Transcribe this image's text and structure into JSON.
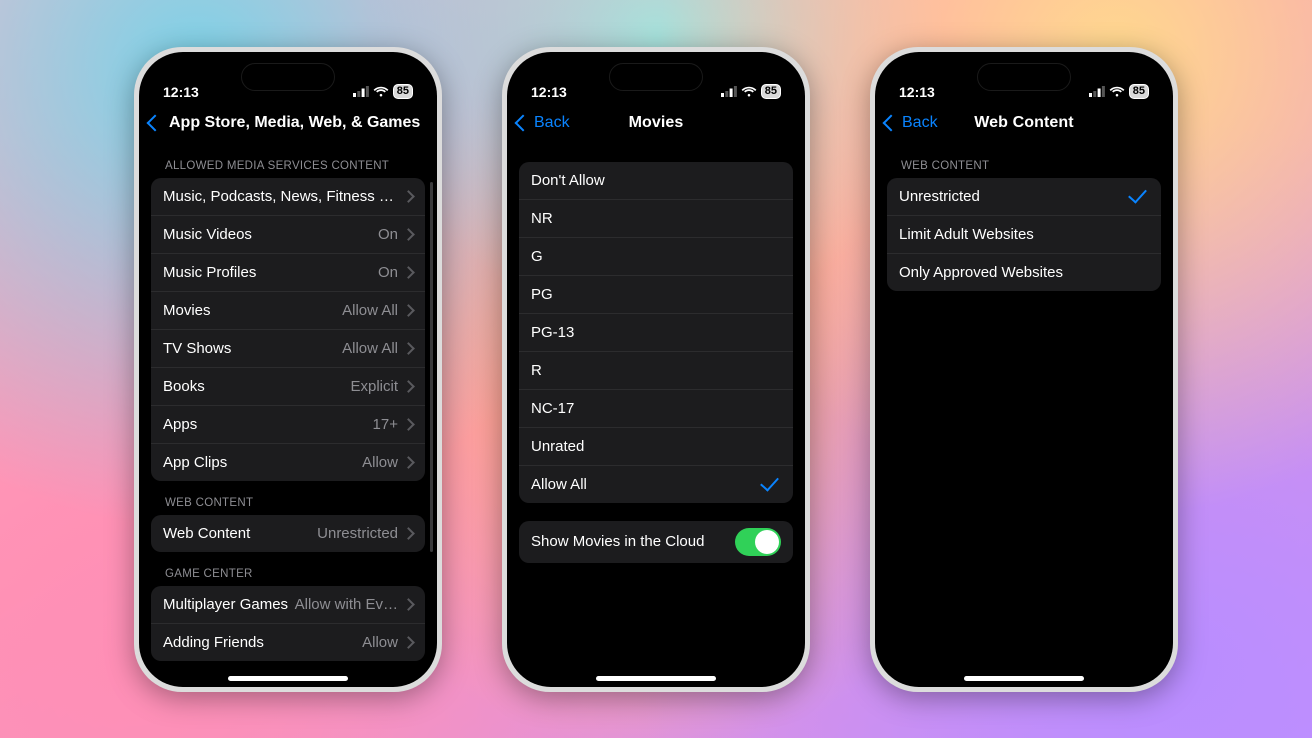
{
  "status": {
    "time": "12:13",
    "battery": "85"
  },
  "phone1": {
    "nav_title": "App Store, Media, Web, & Games",
    "sect1_header": "ALLOWED MEDIA SERVICES CONTENT",
    "rows1": [
      {
        "label": "Music, Podcasts, News, Fitness  …",
        "value": ""
      },
      {
        "label": "Music Videos",
        "value": "On"
      },
      {
        "label": "Music Profiles",
        "value": "On"
      },
      {
        "label": "Movies",
        "value": "Allow All"
      },
      {
        "label": "TV Shows",
        "value": "Allow All"
      },
      {
        "label": "Books",
        "value": "Explicit"
      },
      {
        "label": "Apps",
        "value": "17+"
      },
      {
        "label": "App Clips",
        "value": "Allow"
      }
    ],
    "sect2_header": "WEB CONTENT",
    "row_web": {
      "label": "Web Content",
      "value": "Unrestricted"
    },
    "sect3_header": "GAME CENTER",
    "rows3": [
      {
        "label": "Multiplayer Games",
        "value": "Allow with Ev…"
      },
      {
        "label": "Adding Friends",
        "value": "Allow"
      }
    ]
  },
  "phone2": {
    "back": "Back",
    "nav_title": "Movies",
    "options": [
      "Don't Allow",
      "NR",
      "G",
      "PG",
      "PG-13",
      "R",
      "NC-17",
      "Unrated",
      "Allow All"
    ],
    "selected_index": 8,
    "toggle_label": "Show Movies in the Cloud",
    "toggle_on": true
  },
  "phone3": {
    "back": "Back",
    "nav_title": "Web Content",
    "sect_header": "WEB CONTENT",
    "options": [
      "Unrestricted",
      "Limit Adult Websites",
      "Only Approved Websites"
    ],
    "selected_index": 0
  }
}
